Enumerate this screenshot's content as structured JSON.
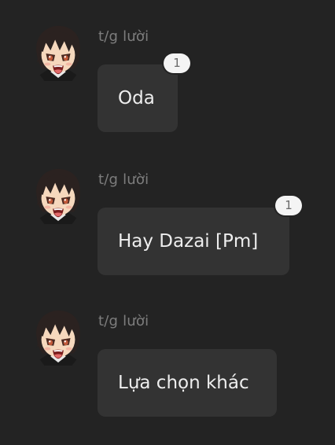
{
  "messages": [
    {
      "author": "t/g lười",
      "text": "Oda",
      "badge": "1"
    },
    {
      "author": "t/g lười",
      "text": "Hay Dazai [Pm]",
      "badge": "1"
    },
    {
      "author": "t/g lười",
      "text": "Lựa chọn khác"
    }
  ],
  "colors": {
    "background": "#232323",
    "bubble": "#333333",
    "author_text": "#7d7d7d",
    "badge": "#f4f4f4"
  },
  "icons": {
    "avatar": "anime-boy-avatar-icon"
  }
}
